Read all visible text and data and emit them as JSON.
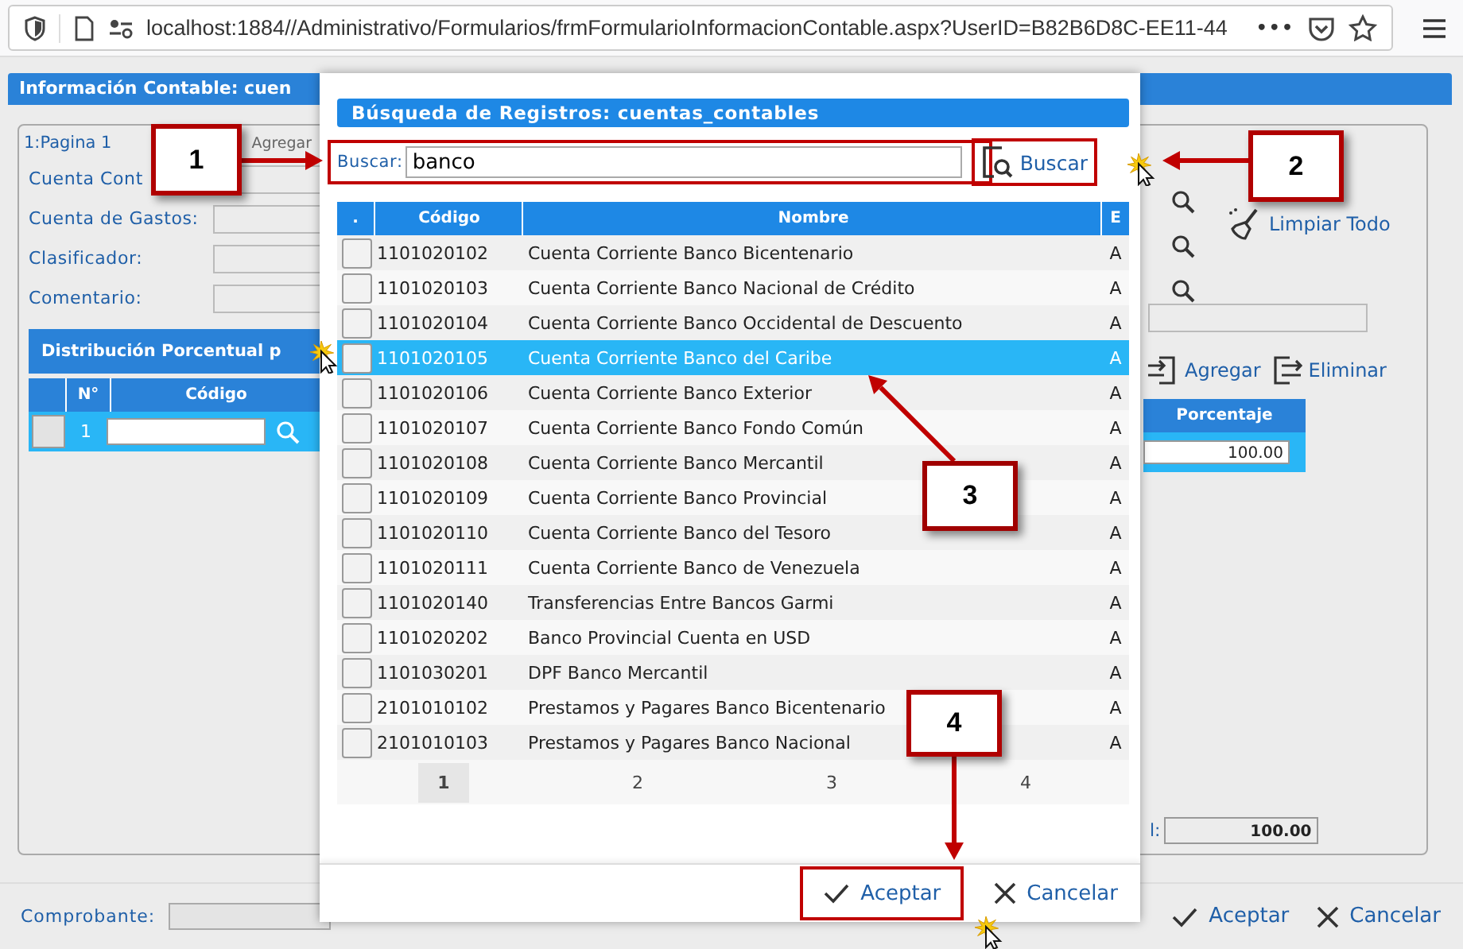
{
  "browser": {
    "url": "localhost:1884//Administrativo/Formularios/frmFormularioInformacionContable.aspx?UserID=B82B6D8C-EE11-44",
    "more": "•••"
  },
  "form": {
    "title": "Información Contable: cuen",
    "tabs": [
      {
        "label": "1:Pagina 1",
        "selected": true
      },
      {
        "label": "Agregar",
        "selected": false
      }
    ],
    "fields": [
      {
        "label": "Cuenta Cont",
        "kind": "lookup"
      },
      {
        "label": "Cuenta de Gastos:",
        "kind": "lookup"
      },
      {
        "label": "Clasificador:",
        "kind": "lookup"
      },
      {
        "label": "Comentario:",
        "kind": "text"
      }
    ],
    "clear_button": "Limpiar Todo",
    "section_title": "Distribución Porcentual p",
    "grid_buttons": [
      {
        "label": "Agregar",
        "kind": "add"
      },
      {
        "label": "Eliminar",
        "kind": "remove"
      }
    ],
    "grid_columns": [
      "N°",
      "Código",
      "Porcentaje"
    ],
    "grid_rows": [
      {
        "number": "1",
        "percent": "100.00",
        "selected": true
      }
    ],
    "total": {
      "label": "l:",
      "value": "100.00"
    }
  },
  "footer": {
    "label": "Comprobante:",
    "buttons": [
      {
        "label": "Aceptar",
        "kind": "ok"
      },
      {
        "label": "Cancelar",
        "kind": "cancel"
      }
    ]
  },
  "dialog": {
    "title": "Búsqueda de Registros: cuentas_contables",
    "search": {
      "label": "Buscar:",
      "value": "banco",
      "button": "Buscar"
    },
    "columns": [
      ".",
      "Código",
      "Nombre",
      "E"
    ],
    "rows": [
      {
        "code": "1101020102",
        "name": "Cuenta Corriente Banco Bicentenario",
        "e": "A",
        "selected": false,
        "checked": false
      },
      {
        "code": "1101020103",
        "name": "Cuenta Corriente Banco Nacional de Crédito",
        "e": "A",
        "selected": false,
        "checked": false
      },
      {
        "code": "1101020104",
        "name": "Cuenta Corriente Banco Occidental de Descuento",
        "e": "A",
        "selected": false,
        "checked": false
      },
      {
        "code": "1101020105",
        "name": "Cuenta Corriente Banco del Caribe",
        "e": "A",
        "selected": true,
        "checked": false
      },
      {
        "code": "1101020106",
        "name": "Cuenta Corriente Banco Exterior",
        "e": "A",
        "selected": false,
        "checked": false
      },
      {
        "code": "1101020107",
        "name": "Cuenta Corriente Banco Fondo Común",
        "e": "A",
        "selected": false,
        "checked": false
      },
      {
        "code": "1101020108",
        "name": "Cuenta Corriente Banco Mercantil",
        "e": "A",
        "selected": false,
        "checked": false
      },
      {
        "code": "1101020109",
        "name": "Cuenta Corriente Banco Provincial",
        "e": "A",
        "selected": false,
        "checked": false
      },
      {
        "code": "1101020110",
        "name": "Cuenta Corriente Banco del Tesoro",
        "e": "A",
        "selected": false,
        "checked": false
      },
      {
        "code": "1101020111",
        "name": "Cuenta Corriente Banco de Venezuela",
        "e": "A",
        "selected": false,
        "checked": false
      },
      {
        "code": "1101020140",
        "name": "Transferencias Entre Bancos Garmi",
        "e": "A",
        "selected": false,
        "checked": false
      },
      {
        "code": "1101020202",
        "name": "Banco Provincial Cuenta en USD",
        "e": "A",
        "selected": false,
        "checked": false
      },
      {
        "code": "1101030201",
        "name": "DPF Banco Mercantil",
        "e": "A",
        "selected": false,
        "checked": false
      },
      {
        "code": "2101010102",
        "name": "Prestamos y Pagares Banco Bicentenario",
        "e": "A",
        "selected": false,
        "checked": false
      },
      {
        "code": "2101010103",
        "name": "Prestamos y Pagares Banco Nacional",
        "e": "A",
        "selected": false,
        "checked": false
      }
    ],
    "pages": [
      {
        "label": "1",
        "selected": true
      },
      {
        "label": "2",
        "selected": false
      },
      {
        "label": "3",
        "selected": false
      },
      {
        "label": "4",
        "selected": false
      }
    ],
    "buttons": [
      {
        "label": "Aceptar",
        "kind": "ok"
      },
      {
        "label": "Cancelar",
        "kind": "cancel"
      }
    ]
  },
  "callouts": [
    {
      "label": "1",
      "highlight": true,
      "click": false
    },
    {
      "label": "2",
      "highlight": true,
      "click": true
    },
    {
      "label": "3",
      "highlight": false,
      "click": true
    },
    {
      "label": "4",
      "highlight": true,
      "click": true
    }
  ]
}
